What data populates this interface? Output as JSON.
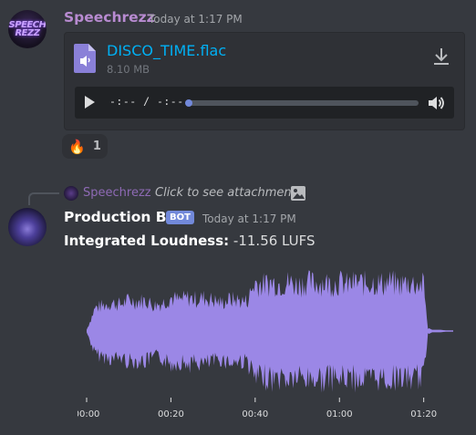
{
  "message1": {
    "username": "Speechrezz",
    "timestamp": "Today at 1:17 PM",
    "avatar_text": "SPEECH REZZ",
    "attachment": {
      "filename": "DISCO_TIME.flac",
      "filesize": "8.10 MB",
      "player": {
        "time": "-:-- / -:--",
        "progress": 0
      }
    },
    "reaction": {
      "emoji": "🔥",
      "count": "1"
    }
  },
  "message2": {
    "reply": {
      "username": "Speechrezz",
      "text": "Click to see attachment"
    },
    "username": "Production Bot",
    "bot_tag": "BOT",
    "timestamp": "Today at 1:17 PM",
    "content_label": "Integrated Loudness:",
    "content_value": " -11.56 LUFS"
  },
  "colors": {
    "background": "#36393f",
    "link": "#00b0f4",
    "username": "#b88bd1",
    "bot_tag": "#7289da",
    "waveform": "#9b87e6"
  },
  "icons": [
    "file-audio-icon",
    "download-icon",
    "play-icon",
    "volume-icon",
    "fire-emoji",
    "image-icon"
  ],
  "chart_data": {
    "type": "area",
    "title": "",
    "xlabel": "",
    "ylabel": "",
    "x_ticks": [
      "00:00",
      "00:20",
      "00:40",
      "01:00",
      "01:20"
    ],
    "x_tick_seconds": [
      0,
      20,
      40,
      60,
      80
    ],
    "xlim": [
      0,
      87
    ],
    "ylim": [
      -1,
      1
    ],
    "color": "#9b87e6",
    "series": [
      {
        "x": [
          0,
          2,
          4,
          6,
          8,
          10,
          12,
          14,
          16,
          18,
          20,
          22,
          24,
          26,
          28,
          30,
          32,
          34,
          36,
          38,
          40,
          42,
          44,
          46,
          48,
          50,
          52,
          54,
          56,
          58,
          60,
          62,
          64,
          66,
          68,
          70,
          72,
          74,
          76,
          78,
          80,
          81,
          82,
          84,
          86
        ],
        "y": [
          0.02,
          0.45,
          0.5,
          0.55,
          0.52,
          0.6,
          0.58,
          0.6,
          0.5,
          0.55,
          0.65,
          0.6,
          0.65,
          0.62,
          0.65,
          0.6,
          0.55,
          0.62,
          0.6,
          0.58,
          0.95,
          0.9,
          0.95,
          0.92,
          0.95,
          0.9,
          0.95,
          0.93,
          0.95,
          0.92,
          0.95,
          0.9,
          0.95,
          0.93,
          0.95,
          0.92,
          0.95,
          0.9,
          0.95,
          0.92,
          0.9,
          0.05,
          0.02,
          0.02,
          0.0
        ]
      }
    ]
  }
}
